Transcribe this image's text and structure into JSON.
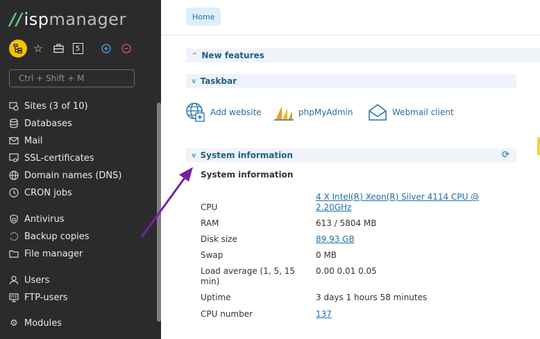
{
  "brand": {
    "mark": "//",
    "isp": "isp",
    "manager": "manager"
  },
  "toolbar": {
    "badge_count": "5"
  },
  "search": {
    "placeholder": "Ctrl + Shift + M"
  },
  "nav": {
    "items": [
      {
        "label": "Sites (3 of 10)",
        "icon": "sites-icon"
      },
      {
        "label": "Databases",
        "icon": "database-icon"
      },
      {
        "label": "Mail",
        "icon": "mail-icon"
      },
      {
        "label": "SSL-certificates",
        "icon": "certificate-icon"
      },
      {
        "label": "Domain names (DNS)",
        "icon": "globe-icon"
      },
      {
        "label": "CRON jobs",
        "icon": "clock-icon"
      },
      {
        "label": "Antivirus",
        "icon": "shield-icon"
      },
      {
        "label": "Backup copies",
        "icon": "backup-icon"
      },
      {
        "label": "File manager",
        "icon": "folder-icon"
      },
      {
        "label": "Users",
        "icon": "user-icon"
      },
      {
        "label": "FTP-users",
        "icon": "ftp-icon"
      },
      {
        "label": "Modules",
        "icon": "gear-icon"
      }
    ]
  },
  "breadcrumb": {
    "home": "Home"
  },
  "panels": {
    "new_features": "New features",
    "taskbar": "Taskbar",
    "system_info": "System information"
  },
  "tasks": [
    {
      "label": "Add website",
      "icon": "add-website-icon"
    },
    {
      "label": "phpMyAdmin",
      "icon": "phpmyadmin-icon"
    },
    {
      "label": "Webmail client",
      "icon": "webmail-icon"
    }
  ],
  "system": {
    "title": "System information",
    "rows": [
      {
        "label": "CPU",
        "value": "4 X Intel(R) Xeon(R) Silver 4114 CPU @ 2.20GHz",
        "link": true
      },
      {
        "label": "RAM",
        "value": "613 / 5804 MB",
        "link": false
      },
      {
        "label": "Disk size",
        "value": "89.93 GB",
        "link": true
      },
      {
        "label": "Swap",
        "value": "0 MB",
        "link": false
      },
      {
        "label": "Load average (1, 5, 15 min)",
        "value": "0.00 0.01 0.05",
        "link": false
      },
      {
        "label": "Uptime",
        "value": "3 days 1 hours 58 minutes",
        "link": false
      },
      {
        "label": "CPU number",
        "value": "137",
        "link": true
      }
    ]
  },
  "colors": {
    "sidebar_bg": "#2b2b2e",
    "accent": "#1f6fa7",
    "brand_green": "#5fcf7a",
    "highlight_yellow": "#f5c400",
    "arrow": "#7b1fa2"
  }
}
